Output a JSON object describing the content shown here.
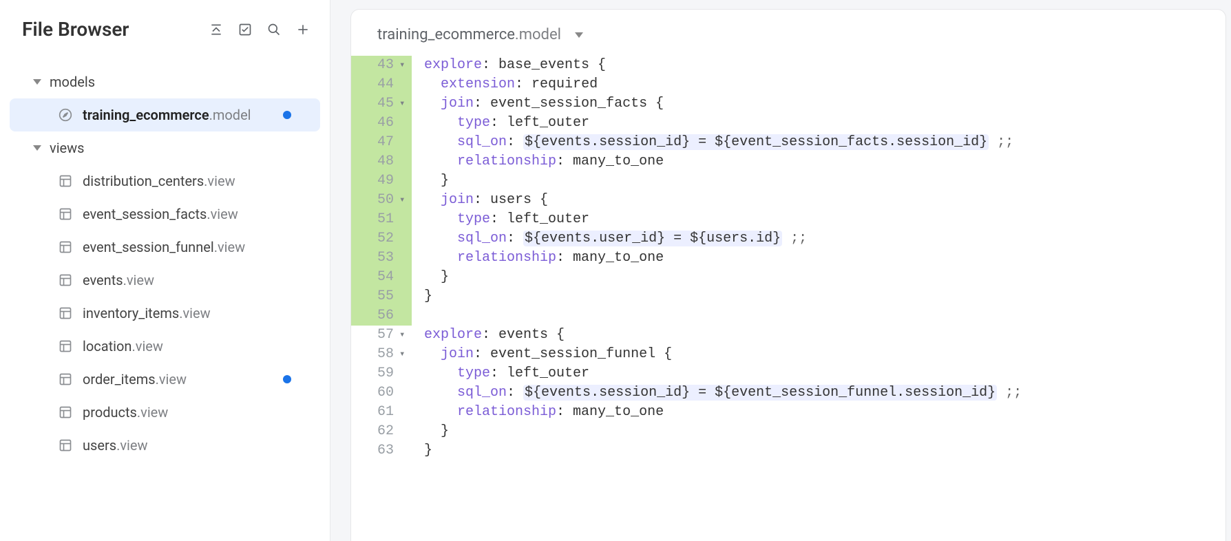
{
  "sidebar": {
    "title": "File Browser",
    "folders": [
      {
        "label": "models",
        "items": [
          {
            "icon": "compass",
            "name_main": "training_ecommerce",
            "name_ext": ".model",
            "selected": true,
            "modified": true
          }
        ]
      },
      {
        "label": "views",
        "items": [
          {
            "icon": "table",
            "name_main": "distribution_centers",
            "name_ext": ".view",
            "selected": false,
            "modified": false
          },
          {
            "icon": "table",
            "name_main": "event_session_facts",
            "name_ext": ".view",
            "selected": false,
            "modified": false
          },
          {
            "icon": "table",
            "name_main": "event_session_funnel",
            "name_ext": ".view",
            "selected": false,
            "modified": false
          },
          {
            "icon": "table",
            "name_main": "events",
            "name_ext": ".view",
            "selected": false,
            "modified": false
          },
          {
            "icon": "table",
            "name_main": "inventory_items",
            "name_ext": ".view",
            "selected": false,
            "modified": false
          },
          {
            "icon": "table",
            "name_main": "location",
            "name_ext": ".view",
            "selected": false,
            "modified": false
          },
          {
            "icon": "table",
            "name_main": "order_items",
            "name_ext": ".view",
            "selected": false,
            "modified": true
          },
          {
            "icon": "table",
            "name_main": "products",
            "name_ext": ".view",
            "selected": false,
            "modified": false
          },
          {
            "icon": "table",
            "name_main": "users",
            "name_ext": ".view",
            "selected": false,
            "modified": false
          }
        ]
      }
    ]
  },
  "editor": {
    "tab": {
      "name_main": "training_ecommerce",
      "name_ext": ".model"
    },
    "lines": [
      {
        "num": 43,
        "added": true,
        "fold": true,
        "tokens": [
          {
            "t": "explore",
            "c": "kw"
          },
          {
            "t": ": base_events {",
            "c": null
          }
        ]
      },
      {
        "num": 44,
        "added": true,
        "fold": false,
        "tokens": [
          {
            "t": "  ",
            "c": null
          },
          {
            "t": "extension",
            "c": "kw"
          },
          {
            "t": ": required",
            "c": null
          }
        ]
      },
      {
        "num": 45,
        "added": true,
        "fold": true,
        "tokens": [
          {
            "t": "  ",
            "c": null
          },
          {
            "t": "join",
            "c": "kw"
          },
          {
            "t": ": event_session_facts {",
            "c": null
          }
        ]
      },
      {
        "num": 46,
        "added": true,
        "fold": false,
        "tokens": [
          {
            "t": "    ",
            "c": null
          },
          {
            "t": "type",
            "c": "kw"
          },
          {
            "t": ": left_outer",
            "c": null
          }
        ]
      },
      {
        "num": 47,
        "added": true,
        "fold": false,
        "tokens": [
          {
            "t": "    ",
            "c": null
          },
          {
            "t": "sql_on",
            "c": "kw"
          },
          {
            "t": ": ",
            "c": null
          },
          {
            "t": "${events.session_id} = ${event_session_facts.session_id}",
            "c": "expr"
          },
          {
            "t": " ;;",
            "c": "punct"
          }
        ]
      },
      {
        "num": 48,
        "added": true,
        "fold": false,
        "tokens": [
          {
            "t": "    ",
            "c": null
          },
          {
            "t": "relationship",
            "c": "kw"
          },
          {
            "t": ": many_to_one",
            "c": null
          }
        ]
      },
      {
        "num": 49,
        "added": true,
        "fold": false,
        "tokens": [
          {
            "t": "  }",
            "c": null
          }
        ]
      },
      {
        "num": 50,
        "added": true,
        "fold": true,
        "tokens": [
          {
            "t": "  ",
            "c": null
          },
          {
            "t": "join",
            "c": "kw"
          },
          {
            "t": ": users {",
            "c": null
          }
        ]
      },
      {
        "num": 51,
        "added": true,
        "fold": false,
        "tokens": [
          {
            "t": "    ",
            "c": null
          },
          {
            "t": "type",
            "c": "kw"
          },
          {
            "t": ": left_outer",
            "c": null
          }
        ]
      },
      {
        "num": 52,
        "added": true,
        "fold": false,
        "tokens": [
          {
            "t": "    ",
            "c": null
          },
          {
            "t": "sql_on",
            "c": "kw"
          },
          {
            "t": ": ",
            "c": null
          },
          {
            "t": "${events.user_id} = ${users.id}",
            "c": "expr"
          },
          {
            "t": " ;;",
            "c": "punct"
          }
        ]
      },
      {
        "num": 53,
        "added": true,
        "fold": false,
        "tokens": [
          {
            "t": "    ",
            "c": null
          },
          {
            "t": "relationship",
            "c": "kw"
          },
          {
            "t": ": many_to_one",
            "c": null
          }
        ]
      },
      {
        "num": 54,
        "added": true,
        "fold": false,
        "tokens": [
          {
            "t": "  }",
            "c": null
          }
        ]
      },
      {
        "num": 55,
        "added": true,
        "fold": false,
        "tokens": [
          {
            "t": "}",
            "c": null
          }
        ]
      },
      {
        "num": 56,
        "added": true,
        "fold": false,
        "tokens": [
          {
            "t": "",
            "c": null
          }
        ]
      },
      {
        "num": 57,
        "added": false,
        "fold": true,
        "tokens": [
          {
            "t": "explore",
            "c": "kw"
          },
          {
            "t": ": events {",
            "c": null
          }
        ]
      },
      {
        "num": 58,
        "added": false,
        "fold": true,
        "tokens": [
          {
            "t": "  ",
            "c": null
          },
          {
            "t": "join",
            "c": "kw"
          },
          {
            "t": ": event_session_funnel {",
            "c": null
          }
        ]
      },
      {
        "num": 59,
        "added": false,
        "fold": false,
        "tokens": [
          {
            "t": "    ",
            "c": null
          },
          {
            "t": "type",
            "c": "kw"
          },
          {
            "t": ": left_outer",
            "c": null
          }
        ]
      },
      {
        "num": 60,
        "added": false,
        "fold": false,
        "tokens": [
          {
            "t": "    ",
            "c": null
          },
          {
            "t": "sql_on",
            "c": "kw"
          },
          {
            "t": ": ",
            "c": null
          },
          {
            "t": "${events.session_id} = ${event_session_funnel.session_id}",
            "c": "expr"
          },
          {
            "t": " ;;",
            "c": "punct"
          }
        ]
      },
      {
        "num": 61,
        "added": false,
        "fold": false,
        "tokens": [
          {
            "t": "    ",
            "c": null
          },
          {
            "t": "relationship",
            "c": "kw"
          },
          {
            "t": ": many_to_one",
            "c": null
          }
        ]
      },
      {
        "num": 62,
        "added": false,
        "fold": false,
        "tokens": [
          {
            "t": "  }",
            "c": null
          }
        ]
      },
      {
        "num": 63,
        "added": false,
        "fold": false,
        "tokens": [
          {
            "t": "}",
            "c": null
          }
        ]
      }
    ]
  }
}
